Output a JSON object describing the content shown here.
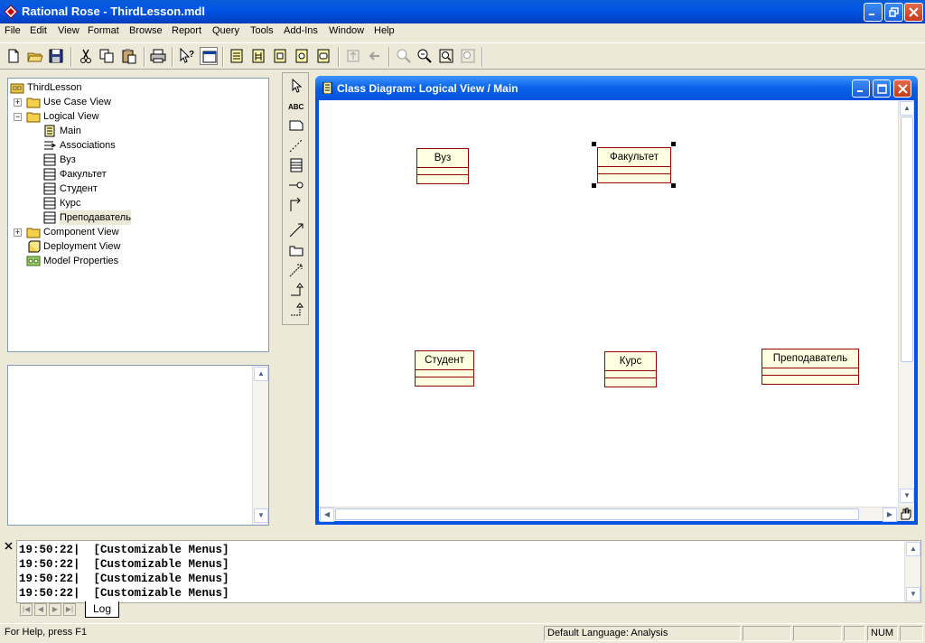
{
  "window": {
    "title": "Rational Rose - ThirdLesson.mdl"
  },
  "menu": [
    "File",
    "Edit",
    "View",
    "Format",
    "Browse",
    "Report",
    "Query",
    "Tools",
    "Add-Ins",
    "Window",
    "Help"
  ],
  "toolbar": {
    "buttons": [
      "new-icon",
      "open-icon",
      "save-icon",
      "cut-icon",
      "copy-icon",
      "paste-icon",
      "print-icon",
      "context-help-icon",
      "view-docs-icon",
      "browse-class-diagram-icon",
      "browse-interaction-diagram-icon",
      "browse-component-diagram-icon",
      "browse-deployment-diagram-icon",
      "browse-parent-icon",
      "browse-previous-icon",
      "zoom-in-icon",
      "zoom-out-icon",
      "fit-in-window-icon",
      "undo-fit-icon"
    ]
  },
  "browser": {
    "root": "ThirdLesson",
    "items": [
      {
        "label": "Use Case View",
        "expander": "+"
      },
      {
        "label": "Logical View",
        "expander": "−"
      },
      {
        "label": "Main"
      },
      {
        "label": "Associations"
      },
      {
        "label": "Вуз"
      },
      {
        "label": "Факультет"
      },
      {
        "label": "Студент"
      },
      {
        "label": "Курс"
      },
      {
        "label": "Преподаватель"
      },
      {
        "label": "Component View",
        "expander": "+"
      },
      {
        "label": "Deployment View"
      },
      {
        "label": "Model Properties"
      }
    ]
  },
  "toolbox": [
    "selection-tool-icon",
    "text-box-tool-icon",
    "note-tool-icon",
    "anchor-note-tool-icon",
    "class-tool-icon",
    "interface-tool-icon",
    "association-tool-icon",
    "unidirectional-association-tool-icon",
    "package-tool-icon",
    "dependency-tool-icon",
    "generalization-tool-icon",
    "realize-tool-icon"
  ],
  "diagram": {
    "title": "Class Diagram: Logical View / Main",
    "classes": [
      {
        "name": "Вуз",
        "selected": false
      },
      {
        "name": "Факультет",
        "selected": true
      },
      {
        "name": "Студент",
        "selected": false
      },
      {
        "name": "Курс",
        "selected": false
      },
      {
        "name": "Преподаватель",
        "selected": false
      }
    ]
  },
  "log": {
    "lines": [
      "19:50:22|  [Customizable Menus]",
      "19:50:22|  [Customizable Menus]",
      "19:50:22|  [Customizable Menus]",
      "19:50:22|  [Customizable Menus]"
    ],
    "tab": "Log"
  },
  "status": {
    "help": "For Help, press F1",
    "language": "Default Language: Analysis",
    "num": "NUM"
  },
  "colors": {
    "title_bar": "#0055E5",
    "class_fill": "#FFFFE1",
    "class_border": "#990000",
    "face": "#ECE9D8"
  }
}
